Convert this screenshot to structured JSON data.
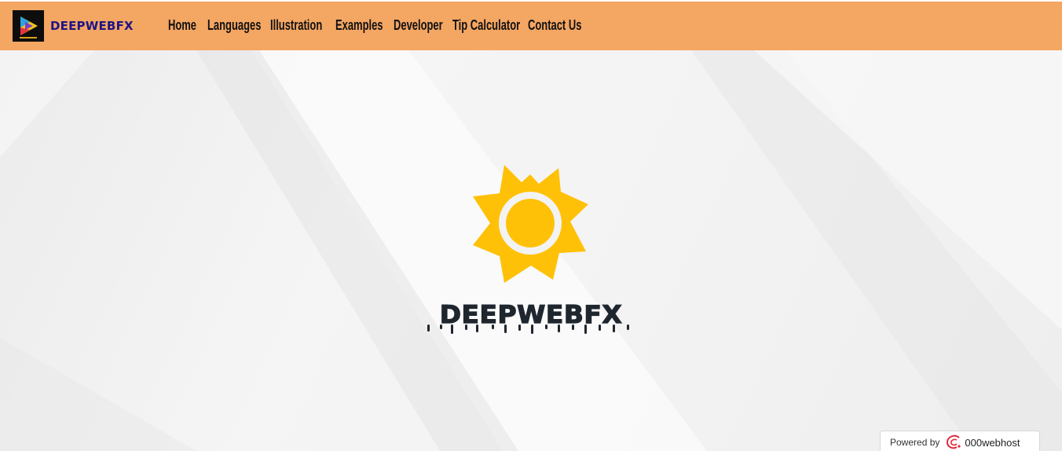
{
  "brand": {
    "name": "DEEPWEBFX",
    "logo_icon": "play-logo-icon"
  },
  "nav": {
    "items": [
      {
        "label": "Home"
      },
      {
        "label": "Languages"
      },
      {
        "label": "Illustration"
      },
      {
        "label": "Examples"
      },
      {
        "label": "Developer"
      },
      {
        "label": "Tip Calculator"
      },
      {
        "label": "Contact Us"
      }
    ]
  },
  "hero": {
    "icon": "sun-icon",
    "title": "DEEPWEBFX"
  },
  "footer_badge": {
    "label": "Powered by",
    "brand": "000webhost",
    "icon": "webhost-swirl-icon"
  },
  "colors": {
    "navbar_bg": "#f4a663",
    "brand_text": "#1f1486",
    "sun": "#ffc107",
    "hero_text": "#1f262e"
  }
}
